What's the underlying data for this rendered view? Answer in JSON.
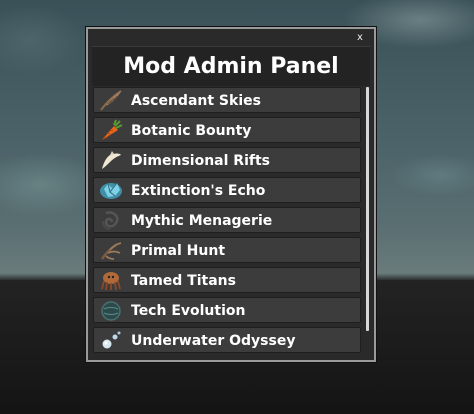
{
  "window": {
    "title": "Mod Admin Panel",
    "close_label": "x"
  },
  "mods": [
    {
      "label": "Ascendant Skies",
      "icon": "feather-icon"
    },
    {
      "label": "Botanic Bounty",
      "icon": "carrot-icon"
    },
    {
      "label": "Dimensional Rifts",
      "icon": "tooth-icon"
    },
    {
      "label": "Extinction's Echo",
      "icon": "crystal-icon"
    },
    {
      "label": "Mythic Menagerie",
      "icon": "coil-icon"
    },
    {
      "label": "Primal Hunt",
      "icon": "claw-icon"
    },
    {
      "label": "Tamed Titans",
      "icon": "creature-icon"
    },
    {
      "label": "Tech Evolution",
      "icon": "orb-icon"
    },
    {
      "label": "Underwater Odyssey",
      "icon": "bubbles-icon"
    }
  ],
  "colors": {
    "panel_bg": "#2a2a2a",
    "item_bg": "#3c3c3c",
    "text": "#ffffff",
    "border": "#9a9a9a"
  }
}
